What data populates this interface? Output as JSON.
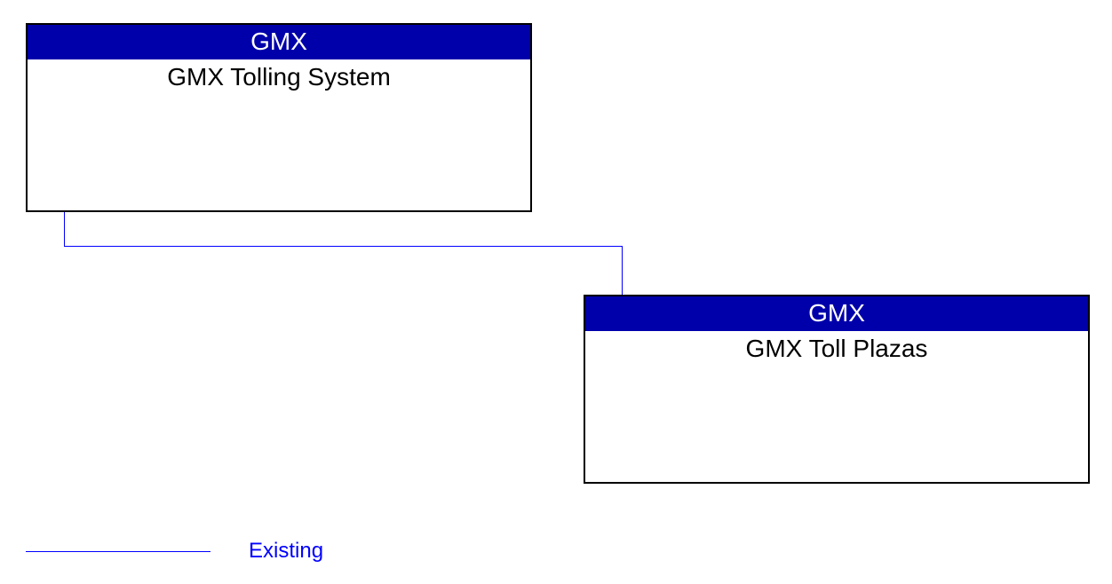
{
  "nodes": {
    "tolling_system": {
      "header": "GMX",
      "title": "GMX Tolling System"
    },
    "toll_plazas": {
      "header": "GMX",
      "title": "GMX Toll Plazas"
    }
  },
  "legend": {
    "existing": "Existing"
  },
  "colors": {
    "header_bg": "#0000AA",
    "connector": "#0000FF",
    "border": "#000000"
  }
}
